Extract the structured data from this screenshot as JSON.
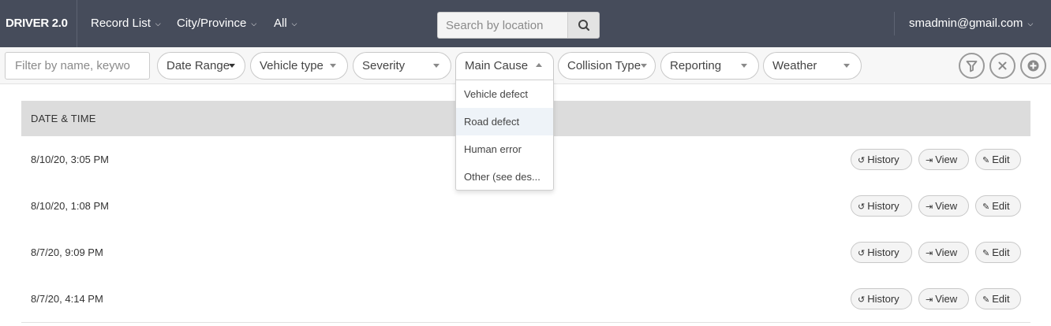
{
  "navbar": {
    "brand": "DRIVER 2.0",
    "menus": [
      {
        "label": "Record List"
      },
      {
        "label": "City/Province"
      },
      {
        "label": "All"
      }
    ],
    "search_placeholder": "Search by location",
    "user_email": "smadmin@gmail.com",
    "background": "#464c5b"
  },
  "filters": {
    "text_placeholder": "Filter by name, keywo",
    "date_range": "Date Range",
    "vehicle_type": "Vehicle type",
    "severity": "Severity",
    "main_cause": "Main Cause",
    "collision_type": "Collision Type",
    "reporting": "Reporting",
    "weather": "Weather",
    "icons": [
      "filter-icon",
      "close-icon",
      "add-icon"
    ]
  },
  "main_cause_dropdown": {
    "options": [
      "Vehicle defect",
      "Road defect",
      "Human error",
      "Other (see des..."
    ],
    "highlighted": "Road defect"
  },
  "table": {
    "header": "DATE & TIME",
    "rows": [
      {
        "date": "8/10/20, 3:05 PM"
      },
      {
        "date": "8/10/20, 1:08 PM"
      },
      {
        "date": "8/7/20, 9:09 PM"
      },
      {
        "date": "8/7/20, 4:14 PM"
      }
    ],
    "actions": {
      "history": "History",
      "view": "View",
      "edit": "Edit"
    }
  }
}
